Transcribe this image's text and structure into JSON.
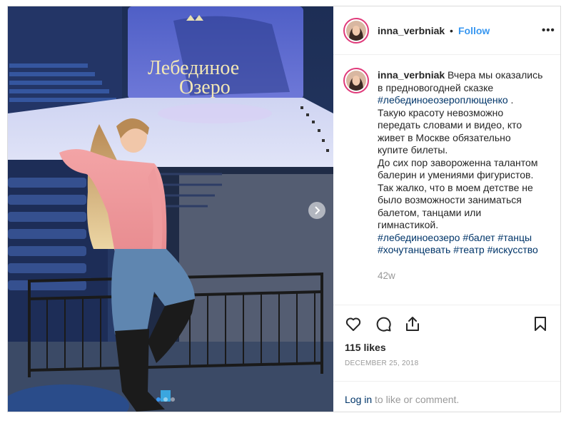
{
  "post": {
    "username": "inna_verbniak",
    "bullet": "•",
    "follow_label": "Follow",
    "more_label": "•••",
    "photo": {
      "sign_line1": "Лебединое",
      "sign_line2": "Озеро",
      "carousel_total": 3,
      "carousel_active": 0
    },
    "caption": {
      "username": "inna_verbniak",
      "text_1": " Вчера мы оказались\nв предновогодней сказке\n",
      "tag_1": "#лебединоеозероплющенко",
      "text_2": " .\nТакую красоту невозможно\nпередать словами и видео, кто\nживет в Москве обязательно\nкупите билеты.\nДо сих пор завороженна талантом\nбалерин и умениями фигуристов.\nТак жалко, что в моем детстве не\nбыло возможности заниматься\nбалетом, танцами или\nгимнастикой.\n",
      "tag_2": "#лебединоеозеро",
      "tag_3": "#балет",
      "tag_4": "#танцы",
      "tag_5": "#хочутанцевать",
      "tag_6": "#театр",
      "tag_7": "#искусство"
    },
    "time_ago": "42w",
    "likes": "115 likes",
    "date": "DECEMBER 25, 2018",
    "comment": {
      "login_label": "Log in",
      "rest": " to like or comment."
    },
    "icons": {
      "like": "heart-icon",
      "comment": "comment-bubble-icon",
      "share": "share-icon",
      "save": "bookmark-icon",
      "next": "chevron-right-icon"
    },
    "colors": {
      "link_blue": "#3897f0",
      "hashtag": "#003569",
      "muted": "#999999",
      "story_ring": "#e03a7a",
      "carousel_dot_active": "#3897f0"
    }
  }
}
